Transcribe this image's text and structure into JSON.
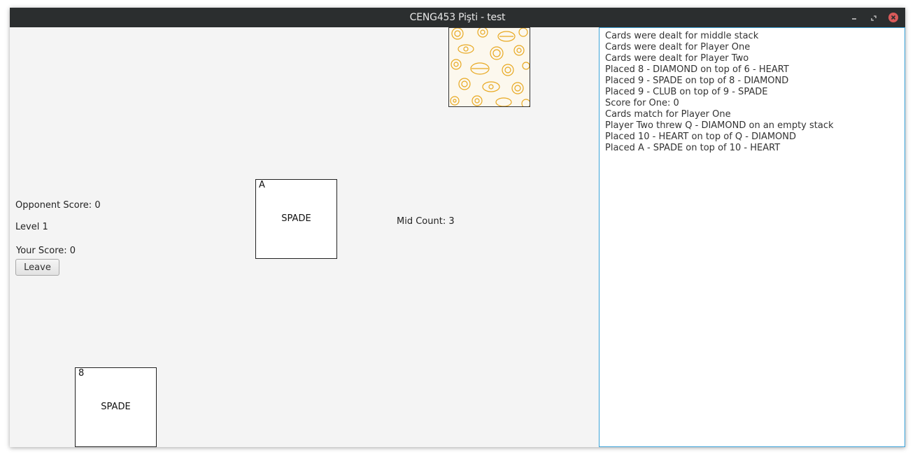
{
  "window": {
    "title": "CENG453 Pişti - test",
    "controls": [
      "minimize-icon",
      "restore-icon",
      "close-icon"
    ]
  },
  "game": {
    "opponent_score": "Opponent Score: 0",
    "level": "Level 1",
    "your_score": "Your Score: 0",
    "leave_label": "Leave",
    "mid_count": "Mid Count: 3",
    "middle_card": {
      "rank": "A",
      "suit": "SPADE"
    },
    "player_card": {
      "rank": "8",
      "suit": "SPADE"
    },
    "opponent_card": {
      "face": "down",
      "pattern": "lemon-pattern"
    }
  },
  "log": {
    "lines": [
      "Cards were dealt for middle stack",
      "Cards were dealt for Player One",
      "Cards were dealt for Player Two",
      "Placed 8 - DIAMOND on top of 6 - HEART",
      "Placed 9 - SPADE on top of 8 - DIAMOND",
      "Placed 9 - CLUB on top of 9 - SPADE",
      "Score for One: 0",
      "Cards match for Player One",
      "Player Two threw Q - DIAMOND on an empty stack",
      "Placed 10 - HEART on top of Q - DIAMOND",
      "Placed A - SPADE on top of 10 - HEART"
    ]
  },
  "colors": {
    "titlebar": "#2b2e2f",
    "game_bg": "#f4f4f4",
    "log_border": "#3ca3d8",
    "close_button": "#d95a5a",
    "card_back_pattern": "#e8a820"
  }
}
